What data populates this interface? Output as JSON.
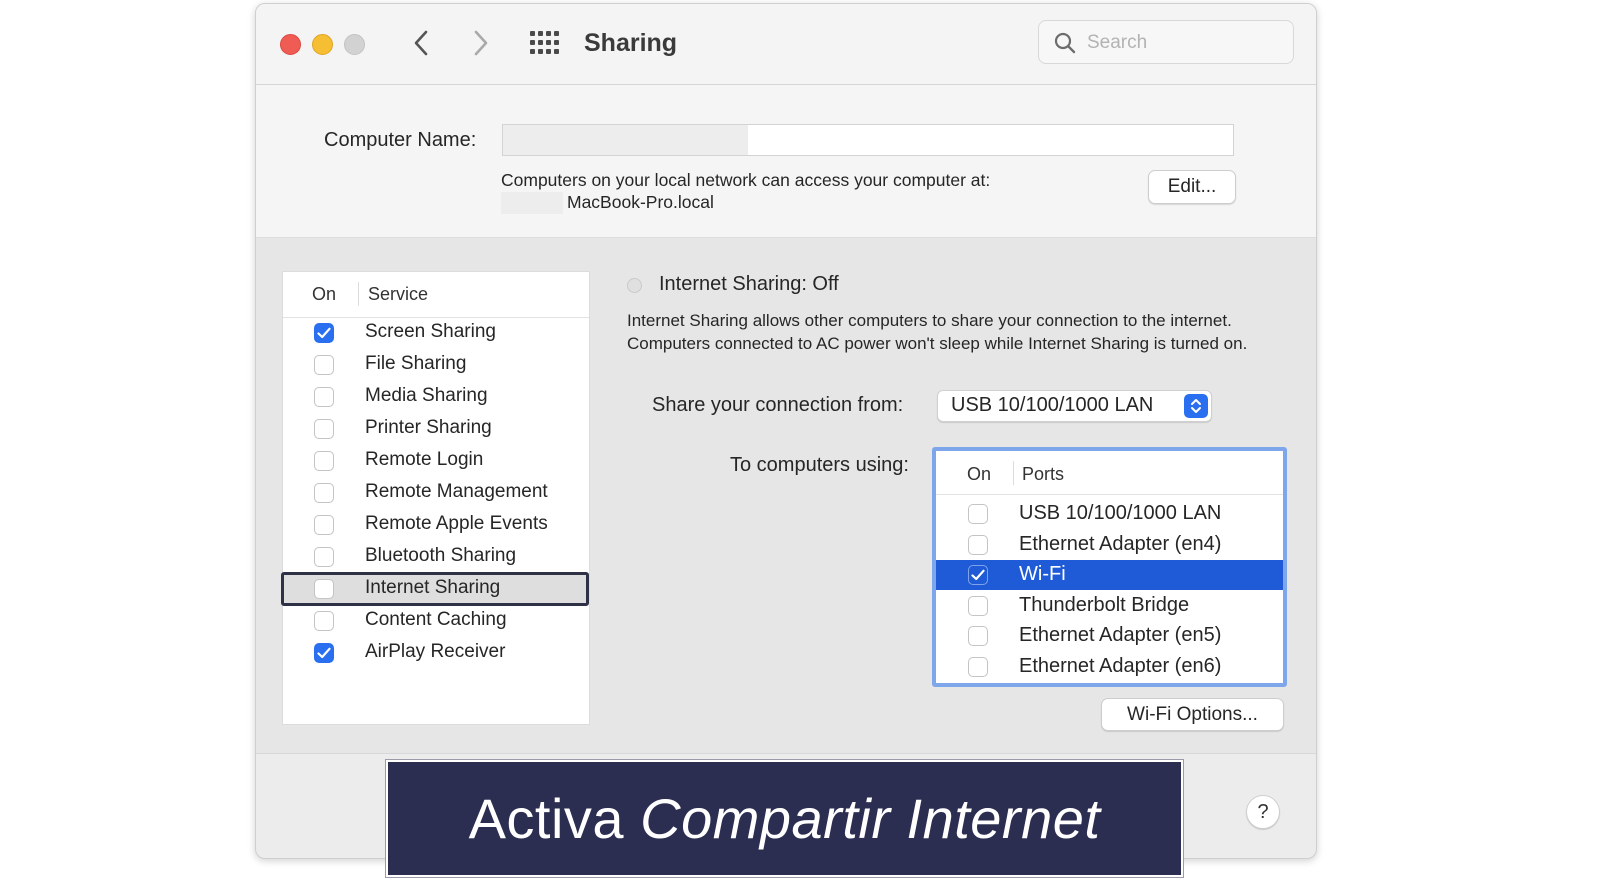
{
  "window": {
    "title": "Sharing",
    "search": {
      "placeholder": "Search",
      "value": ""
    }
  },
  "computer_name": {
    "label": "Computer Name:",
    "access_text": "Computers on your local network can access your computer at:",
    "hostname_suffix": "MacBook-Pro.local",
    "edit_button": "Edit..."
  },
  "services": {
    "header_on": "On",
    "header_service": "Service",
    "items": [
      {
        "label": "Screen Sharing",
        "checked": true
      },
      {
        "label": "File Sharing",
        "checked": false
      },
      {
        "label": "Media Sharing",
        "checked": false
      },
      {
        "label": "Printer Sharing",
        "checked": false
      },
      {
        "label": "Remote Login",
        "checked": false
      },
      {
        "label": "Remote Management",
        "checked": false
      },
      {
        "label": "Remote Apple Events",
        "checked": false
      },
      {
        "label": "Bluetooth Sharing",
        "checked": false
      },
      {
        "label": "Internet Sharing",
        "checked": false,
        "selected": true
      },
      {
        "label": "Content Caching",
        "checked": false
      },
      {
        "label": "AirPlay Receiver",
        "checked": true
      }
    ]
  },
  "internet_sharing": {
    "status": "Internet Sharing: Off",
    "description": "Internet Sharing allows other computers to share your connection to the internet. Computers connected to AC power won't sleep while Internet Sharing is turned on.",
    "share_from_label": "Share your connection from:",
    "share_from_value": "USB 10/100/1000 LAN",
    "to_computers_label": "To computers using:",
    "ports_header_on": "On",
    "ports_header_ports": "Ports",
    "ports": [
      {
        "label": "USB 10/100/1000 LAN",
        "checked": false
      },
      {
        "label": "Ethernet Adapter (en4)",
        "checked": false
      },
      {
        "label": "Wi-Fi",
        "checked": true,
        "selected": true
      },
      {
        "label": "Thunderbolt Bridge",
        "checked": false
      },
      {
        "label": "Ethernet Adapter (en5)",
        "checked": false
      },
      {
        "label": "Ethernet Adapter (en6)",
        "checked": false
      }
    ],
    "wifi_options_button": "Wi-Fi Options..."
  },
  "help_button": "?",
  "banner": {
    "text_plain": "Activa ",
    "text_italic": "Compartir Internet"
  },
  "colors": {
    "accent": "#2a6ff0",
    "selection": "#1f5bd6",
    "banner_bg": "#2b2d51"
  },
  "icons": [
    "chevron-left-icon",
    "chevron-right-icon",
    "grid-icon",
    "search-icon",
    "checkmark-icon",
    "select-arrows-icon"
  ]
}
